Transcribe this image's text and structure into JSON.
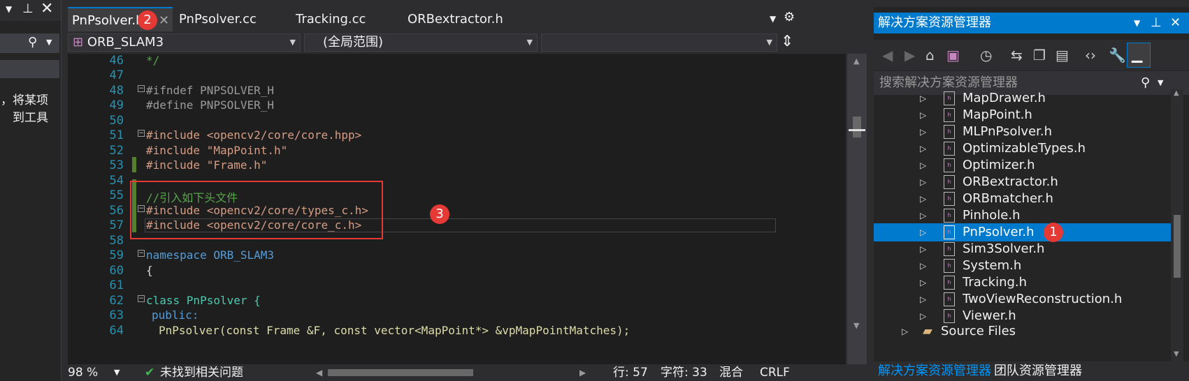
{
  "toolbox": {
    "hint_line1": "，将某项",
    "hint_line2": "到工具"
  },
  "tabs": [
    {
      "label": "PnPsolver.h",
      "badge": "2",
      "active": true
    },
    {
      "label": "PnPsolver.cc"
    },
    {
      "label": "Tracking.cc"
    },
    {
      "label": "ORBextractor.h"
    }
  ],
  "navbar": {
    "project": "ORB_SLAM3",
    "scope": "(全局范围)",
    "member": ""
  },
  "code_lines": [
    {
      "n": "46",
      "text": "*/"
    },
    {
      "n": "47",
      "text": ""
    },
    {
      "n": "48",
      "text": "#ifndef PNPSOLVER_H"
    },
    {
      "n": "49",
      "text": "#define PNPSOLVER_H"
    },
    {
      "n": "50",
      "text": ""
    },
    {
      "n": "51",
      "text": "#include <opencv2/core/core.hpp>"
    },
    {
      "n": "52",
      "text": "#include \"MapPoint.h\""
    },
    {
      "n": "53",
      "text": "#include \"Frame.h\""
    },
    {
      "n": "54",
      "text": ""
    },
    {
      "n": "55",
      "text": "//引入如下头文件"
    },
    {
      "n": "56",
      "text": "#include <opencv2/core/types_c.h>"
    },
    {
      "n": "57",
      "text": "#include <opencv2/core/core_c.h>"
    },
    {
      "n": "58",
      "text": ""
    },
    {
      "n": "59",
      "text": "namespace ORB_SLAM3"
    },
    {
      "n": "60",
      "text": "{"
    },
    {
      "n": "61",
      "text": ""
    },
    {
      "n": "62",
      "text": "class PnPsolver {"
    },
    {
      "n": "63",
      "text": "public:"
    },
    {
      "n": "64",
      "text": "PnPsolver(const Frame &F, const vector<MapPoint*> &vpMapPointMatches);"
    }
  ],
  "annotation_badge": "3",
  "status": {
    "zoom": "98 %",
    "issues": "未找到相关问题",
    "line": "行: 57",
    "char": "字符: 33",
    "mode": "混合",
    "eol": "CRLF"
  },
  "solution_explorer": {
    "title": "解决方案资源管理器",
    "search_placeholder": "搜索解决方案资源管理器",
    "files": [
      {
        "name": "MapDrawer.h"
      },
      {
        "name": "MapPoint.h"
      },
      {
        "name": "MLPnPsolver.h"
      },
      {
        "name": "OptimizableTypes.h"
      },
      {
        "name": "Optimizer.h"
      },
      {
        "name": "ORBextractor.h"
      },
      {
        "name": "ORBmatcher.h"
      },
      {
        "name": "Pinhole.h"
      },
      {
        "name": "PnPsolver.h",
        "selected": true,
        "badge": "1"
      },
      {
        "name": "Sim3Solver.h"
      },
      {
        "name": "System.h"
      },
      {
        "name": "Tracking.h"
      },
      {
        "name": "TwoViewReconstruction.h"
      },
      {
        "name": "Viewer.h"
      }
    ],
    "folder": "Source Files",
    "bottom_tabs": [
      "解决方案资源管理器",
      "团队资源管理器"
    ]
  },
  "colors": {
    "accent": "#007acc",
    "badge": "#e53935",
    "annotation_box": "#e53935"
  }
}
